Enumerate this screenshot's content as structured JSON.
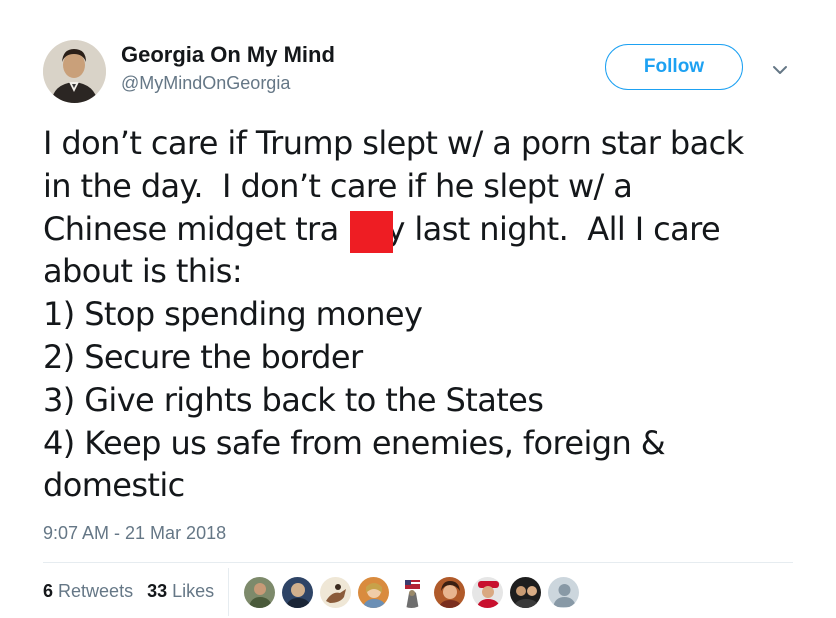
{
  "author": {
    "display_name": "Georgia On My Mind",
    "handle": "@MyMindOnGeorgia",
    "avatar_icon": "profile-avatar"
  },
  "follow_label": "Follow",
  "menu_icon": "chevron-down-icon",
  "tweet": {
    "text": "I don’t care if Trump slept w/ a porn star back\nin the day.  I don’t care if he slept w/ a\nChinese midget tra     y last night.  All I care\nabout is this:\n1) Stop spending money\n2) Secure the border\n3) Give rights back to the States\n4) Keep us safe from enemies, foreign &\ndomestic"
  },
  "timestamp": "9:07 AM - 21 Mar 2018",
  "stats": {
    "retweets_count": "6",
    "retweets_label": "Retweets",
    "likes_count": "33",
    "likes_label": "Likes"
  },
  "colors": {
    "accent": "#1da1f2",
    "redaction": "#ee1d23",
    "muted": "#657786"
  }
}
